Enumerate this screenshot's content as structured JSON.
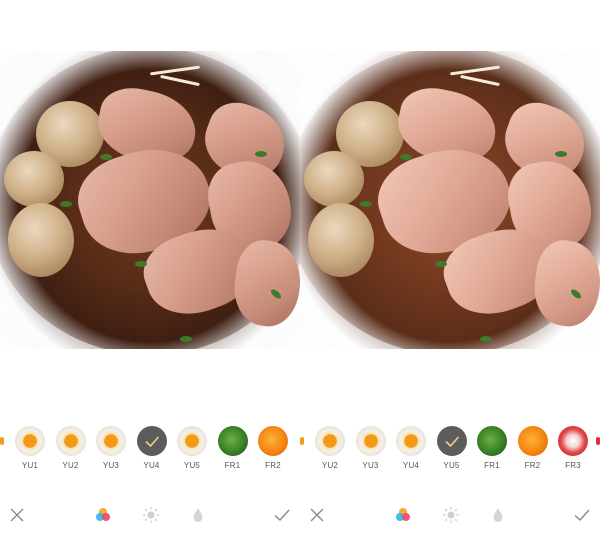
{
  "panels": [
    {
      "variant": "original",
      "filters": [
        {
          "label": "YU1",
          "thumb": "egg",
          "selected": false
        },
        {
          "label": "YU2",
          "thumb": "egg",
          "selected": false
        },
        {
          "label": "YU3",
          "thumb": "egg",
          "selected": false
        },
        {
          "label": "YU4",
          "thumb": "egg",
          "selected": true
        },
        {
          "label": "YU5",
          "thumb": "egg",
          "selected": false
        },
        {
          "label": "FR1",
          "thumb": "herb",
          "selected": false
        },
        {
          "label": "FR2",
          "thumb": "orange",
          "selected": false
        }
      ]
    },
    {
      "variant": "filtered",
      "filters": [
        {
          "label": "YU2",
          "thumb": "egg",
          "selected": false
        },
        {
          "label": "YU3",
          "thumb": "egg",
          "selected": false
        },
        {
          "label": "YU4",
          "thumb": "egg",
          "selected": false
        },
        {
          "label": "YU5",
          "thumb": "egg",
          "selected": true
        },
        {
          "label": "FR1",
          "thumb": "herb",
          "selected": false
        },
        {
          "label": "FR2",
          "thumb": "orange",
          "selected": false
        },
        {
          "label": "FR3",
          "thumb": "berry",
          "selected": false
        }
      ]
    }
  ],
  "toolbar": {
    "icons": [
      "close-icon",
      "filter-icon",
      "brightness-icon",
      "tint-icon",
      "confirm-check-icon"
    ]
  },
  "colors": {
    "icon_gray": "#8a8a8a",
    "label_gray": "#555555",
    "selected_thumb": "#5c5c5c",
    "edge_accent": "#f0a020"
  }
}
